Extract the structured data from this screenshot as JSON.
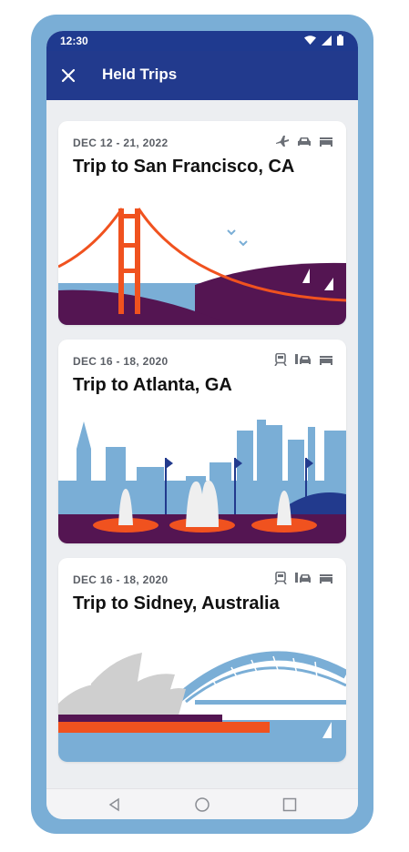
{
  "status": {
    "time": "12:30"
  },
  "header": {
    "title": "Held Trips"
  },
  "trips": [
    {
      "date": "DEC 12 - 21, 2022",
      "title": "Trip to San Francisco, CA",
      "icons": [
        "flight-icon",
        "car-icon",
        "hotel-icon"
      ]
    },
    {
      "date": "DEC 16 - 18, 2020",
      "title": "Trip to Atlanta, GA",
      "icons": [
        "train-icon",
        "car-rental-icon",
        "hotel-icon"
      ]
    },
    {
      "date": "DEC 16 - 18, 2020",
      "title": "Trip to Sidney, Australia",
      "icons": [
        "train-icon",
        "car-rental-icon",
        "hotel-icon"
      ]
    }
  ],
  "colors": {
    "appbar": "#223a8d",
    "device_frame": "#7aaed6",
    "accent_orange": "#f0521f",
    "purple": "#541552",
    "sky_blue": "#7aaed6"
  }
}
